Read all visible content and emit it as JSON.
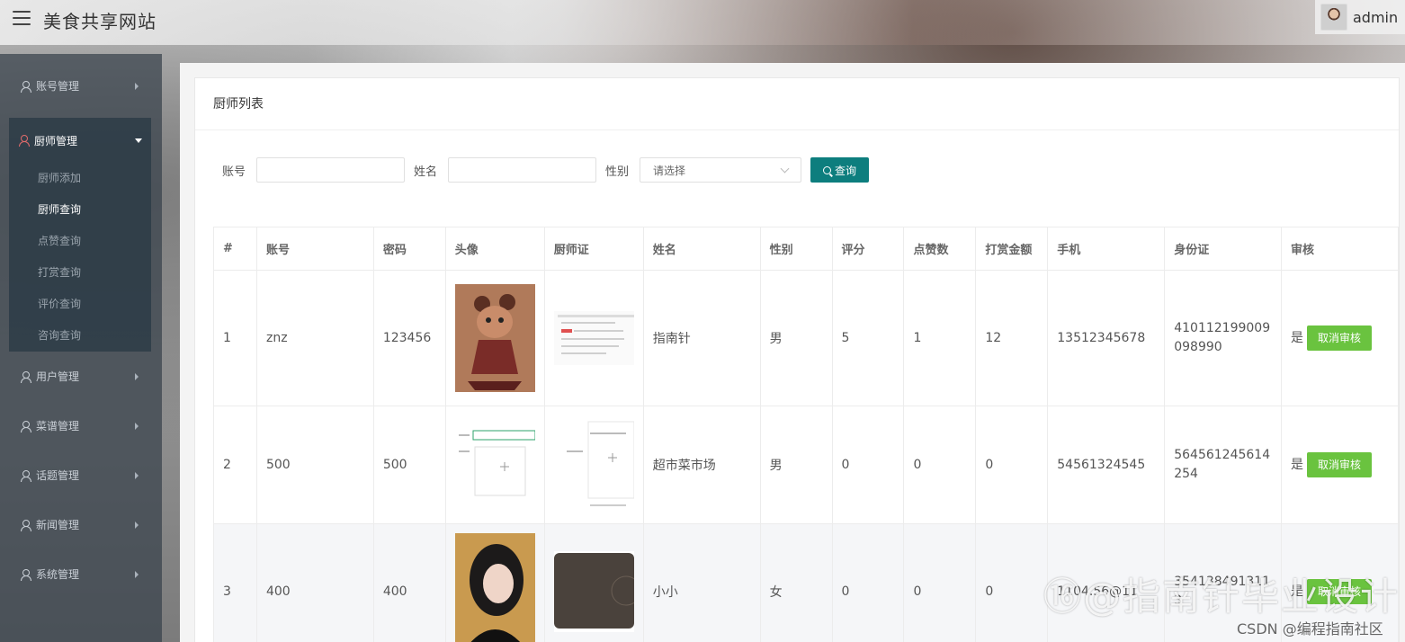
{
  "header": {
    "site_title": "美食共享网站",
    "user_name": "admin"
  },
  "sidebar": {
    "items": [
      {
        "label": "账号管理"
      },
      {
        "label": "厨师管理",
        "sub": [
          "厨师添加",
          "厨师查询",
          "点赞查询",
          "打赏查询",
          "评价查询",
          "咨询查询"
        ],
        "active_sub": "厨师查询"
      },
      {
        "label": "用户管理"
      },
      {
        "label": "菜谱管理"
      },
      {
        "label": "话题管理"
      },
      {
        "label": "新闻管理"
      },
      {
        "label": "系统管理"
      }
    ]
  },
  "card": {
    "title": "厨师列表"
  },
  "search": {
    "account_label": "账号",
    "name_label": "姓名",
    "gender_label": "性别",
    "gender_placeholder": "请选择",
    "button_label": "查询"
  },
  "table": {
    "columns": [
      "#",
      "账号",
      "密码",
      "头像",
      "厨师证",
      "姓名",
      "性别",
      "评分",
      "点赞数",
      "打赏金额",
      "手机",
      "身份证",
      "审核"
    ],
    "rows": [
      {
        "idx": "1",
        "account": "znz",
        "password": "123456",
        "name": "指南针",
        "gender": "男",
        "score": "5",
        "likes": "1",
        "tip": "12",
        "phone": "13512345678",
        "id_card": "410112199009098990",
        "audit": "是",
        "action": "取消审核"
      },
      {
        "idx": "2",
        "account": "500",
        "password": "500",
        "name": "超市菜市场",
        "gender": "男",
        "score": "0",
        "likes": "0",
        "tip": "0",
        "phone": "54561324545",
        "id_card": "564561245614254",
        "audit": "是",
        "action": "取消审核"
      },
      {
        "idx": "3",
        "account": "400",
        "password": "400",
        "name": "小小",
        "gender": "女",
        "score": "0",
        "likes": "0",
        "tip": "0",
        "phone": "1104.56@11",
        "id_card": "3541384913113",
        "audit": "是",
        "action": "取消审核"
      }
    ]
  },
  "watermark": {
    "main": "⑯@指南针毕业设计",
    "sub": "CSDN @编程指南社区"
  },
  "colors": {
    "accent": "#0d7e7e",
    "audit_button": "#6ac33f",
    "sidebar_icon_active": "#e06b6b"
  }
}
